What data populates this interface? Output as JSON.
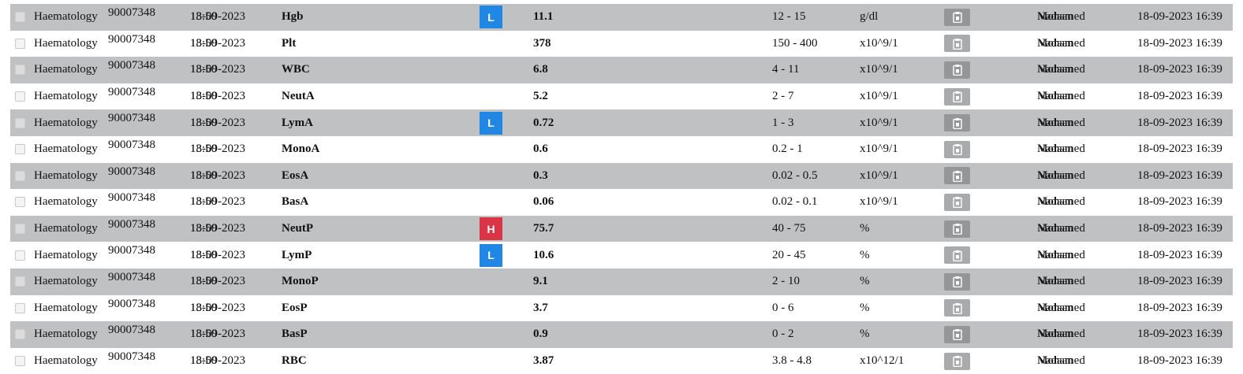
{
  "rows": [
    {
      "department": "Haematology",
      "accession": "90007348",
      "date": "18-09-2023",
      "date_overlay": "13:50",
      "test": "Hgb",
      "flag": "L",
      "result": "11.1",
      "range": "12 - 15",
      "unit": "g/dl",
      "user": "Mohamed",
      "user_overlay": "Nadaan",
      "timestamp": "18-09-2023 16:39"
    },
    {
      "department": "Haematology",
      "accession": "90007348",
      "date": "18-09-2023",
      "date_overlay": "13:50",
      "test": "Plt",
      "flag": "",
      "result": "378",
      "range": "150 - 400",
      "unit": "x10^9/1",
      "user": "Mohamed",
      "user_overlay": "Nadaan",
      "timestamp": "18-09-2023 16:39"
    },
    {
      "department": "Haematology",
      "accession": "90007348",
      "date": "18-09-2023",
      "date_overlay": "13:50",
      "test": "WBC",
      "flag": "",
      "result": "6.8",
      "range": "4 - 11",
      "unit": "x10^9/1",
      "user": "Mohamed",
      "user_overlay": "Nadaan",
      "timestamp": "18-09-2023 16:39"
    },
    {
      "department": "Haematology",
      "accession": "90007348",
      "date": "18-09-2023",
      "date_overlay": "13:50",
      "test": "NeutA",
      "flag": "",
      "result": "5.2",
      "range": "2 - 7",
      "unit": "x10^9/1",
      "user": "Mohamed",
      "user_overlay": "Nadaan",
      "timestamp": "18-09-2023 16:39"
    },
    {
      "department": "Haematology",
      "accession": "90007348",
      "date": "18-09-2023",
      "date_overlay": "13:50",
      "test": "LymA",
      "flag": "L",
      "result": "0.72",
      "range": "1 - 3",
      "unit": "x10^9/1",
      "user": "Mohamed",
      "user_overlay": "Nadaan",
      "timestamp": "18-09-2023 16:39"
    },
    {
      "department": "Haematology",
      "accession": "90007348",
      "date": "18-09-2023",
      "date_overlay": "13:50",
      "test": "MonoA",
      "flag": "",
      "result": "0.6",
      "range": "0.2 - 1",
      "unit": "x10^9/1",
      "user": "Mohamed",
      "user_overlay": "Nadaan",
      "timestamp": "18-09-2023 16:39"
    },
    {
      "department": "Haematology",
      "accession": "90007348",
      "date": "18-09-2023",
      "date_overlay": "13:50",
      "test": "EosA",
      "flag": "",
      "result": "0.3",
      "range": "0.02 - 0.5",
      "unit": "x10^9/1",
      "user": "Mohamed",
      "user_overlay": "Nadaan",
      "timestamp": "18-09-2023 16:39"
    },
    {
      "department": "Haematology",
      "accession": "90007348",
      "date": "18-09-2023",
      "date_overlay": "13:50",
      "test": "BasA",
      "flag": "",
      "result": "0.06",
      "range": "0.02 - 0.1",
      "unit": "x10^9/1",
      "user": "Mohamed",
      "user_overlay": "Nadaan",
      "timestamp": "18-09-2023 16:39"
    },
    {
      "department": "Haematology",
      "accession": "90007348",
      "date": "18-09-2023",
      "date_overlay": "13:50",
      "test": "NeutP",
      "flag": "H",
      "result": "75.7",
      "range": "40 - 75",
      "unit": "%",
      "user": "Mohamed",
      "user_overlay": "Nadaan",
      "timestamp": "18-09-2023 16:39"
    },
    {
      "department": "Haematology",
      "accession": "90007348",
      "date": "18-09-2023",
      "date_overlay": "13:50",
      "test": "LymP",
      "flag": "L",
      "result": "10.6",
      "range": "20 - 45",
      "unit": "%",
      "user": "Mohamed",
      "user_overlay": "Nadaan",
      "timestamp": "18-09-2023 16:39"
    },
    {
      "department": "Haematology",
      "accession": "90007348",
      "date": "18-09-2023",
      "date_overlay": "13:50",
      "test": "MonoP",
      "flag": "",
      "result": "9.1",
      "range": "2 - 10",
      "unit": "%",
      "user": "Mohamed",
      "user_overlay": "Nadaan",
      "timestamp": "18-09-2023 16:39"
    },
    {
      "department": "Haematology",
      "accession": "90007348",
      "date": "18-09-2023",
      "date_overlay": "13:50",
      "test": "EosP",
      "flag": "",
      "result": "3.7",
      "range": "0 - 6",
      "unit": "%",
      "user": "Mohamed",
      "user_overlay": "Nadaan",
      "timestamp": "18-09-2023 16:39"
    },
    {
      "department": "Haematology",
      "accession": "90007348",
      "date": "18-09-2023",
      "date_overlay": "13:50",
      "test": "BasP",
      "flag": "",
      "result": "0.9",
      "range": "0 - 2",
      "unit": "%",
      "user": "Mohamed",
      "user_overlay": "Nadaan",
      "timestamp": "18-09-2023 16:39"
    },
    {
      "department": "Haematology",
      "accession": "90007348",
      "date": "18-09-2023",
      "date_overlay": "13:50",
      "test": "RBC",
      "flag": "",
      "result": "3.87",
      "range": "3.8 - 4.8",
      "unit": "x10^12/1",
      "user": "Mohamed",
      "user_overlay": "Nadaan",
      "timestamp": "18-09-2023 16:39"
    }
  ],
  "colors": {
    "flag_low": "#2187e4",
    "flag_high": "#d93547",
    "row_shaded": "#bfc1c2"
  },
  "icons": {
    "action": "clipboard-icon",
    "select": "checkbox"
  }
}
